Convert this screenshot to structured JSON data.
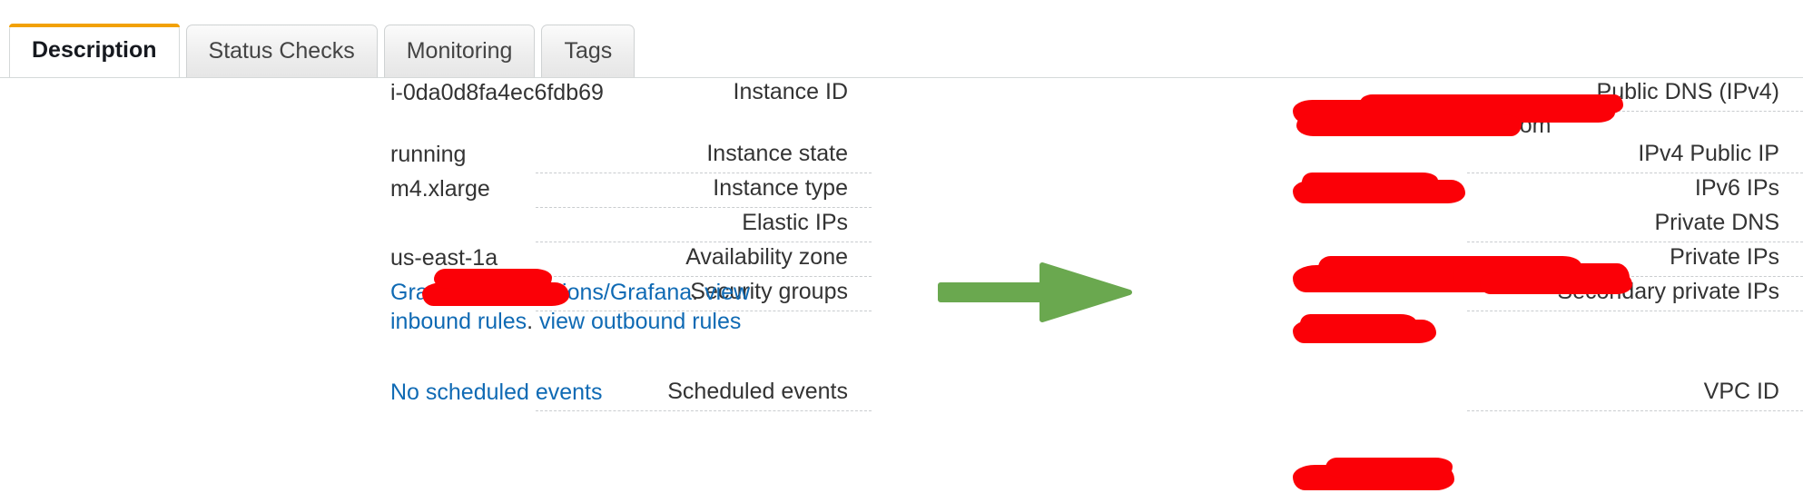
{
  "tabs": [
    {
      "label": "Description",
      "active": true
    },
    {
      "label": "Status Checks",
      "active": false
    },
    {
      "label": "Monitoring",
      "active": false
    },
    {
      "label": "Tags",
      "active": false
    }
  ],
  "details": {
    "left": [
      {
        "label": "Instance ID",
        "value": "i-0da0d8fa4ec6fdb69",
        "redacted": false
      },
      {
        "label": "Instance state",
        "value": "running",
        "redacted": false
      },
      {
        "label": "Instance type",
        "value": "m4.xlarge",
        "redacted": false
      },
      {
        "label": "Elastic IPs",
        "value": "",
        "redacted": true
      },
      {
        "label": "Availability zone",
        "value": "us-east-1a",
        "redacted": false
      },
      {
        "label": "Security groups",
        "value": "",
        "redacted": false,
        "links": [
          {
            "text": "Graphite/Annotations/Grafana"
          },
          {
            "text": "view inbound rules"
          },
          {
            "text": "view outbound rules"
          }
        ],
        "separator": "."
      },
      {
        "label": "Scheduled events",
        "value": "",
        "redacted": false,
        "links": [
          {
            "text": "No scheduled events"
          }
        ]
      }
    ],
    "right": [
      {
        "label": "Public DNS (IPv4)",
        "value": "",
        "value_tail": "1.amazonaws.com",
        "redacted": true
      },
      {
        "label": "IPv4 Public IP",
        "value": "",
        "redacted": true
      },
      {
        "label": "IPv6 IPs",
        "value": "-",
        "redacted": false
      },
      {
        "label": "Private DNS",
        "value": "",
        "redacted": true
      },
      {
        "label": "Private IPs",
        "value": "",
        "redacted": true
      },
      {
        "label": "Secondary private IPs",
        "value": "",
        "redacted": false
      },
      {
        "label": "VPC ID",
        "value": "",
        "redacted": true
      }
    ]
  },
  "annotation": {
    "arrow": "green-right-arrow",
    "points_at": "Private DNS",
    "color": "#6aa84f"
  },
  "colors": {
    "accent": "#f2a104",
    "link": "#0f6ab4",
    "redaction": "#fb0007",
    "arrow": "#6aa84f",
    "text": "#333333",
    "rule": "#c9cccf"
  }
}
